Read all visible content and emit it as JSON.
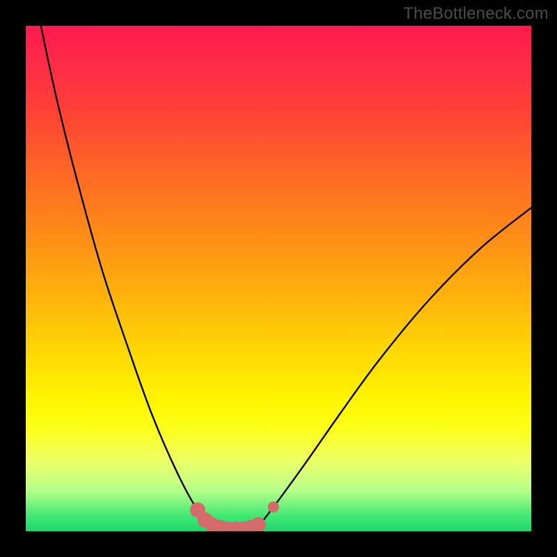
{
  "watermark": {
    "text": "TheBottleneck.com"
  },
  "background": {
    "gradient_stops": [
      {
        "pct": 0,
        "color": "#ff1a4e"
      },
      {
        "pct": 18,
        "color": "#ff4433"
      },
      {
        "pct": 42,
        "color": "#ff8e17"
      },
      {
        "pct": 64,
        "color": "#ffd605"
      },
      {
        "pct": 80,
        "color": "#fbff19"
      },
      {
        "pct": 92,
        "color": "#b6ff8a"
      },
      {
        "pct": 100,
        "color": "#1fd66e"
      }
    ]
  },
  "chart_data": {
    "type": "line",
    "title": "",
    "xlabel": "",
    "ylabel": "",
    "xlim": [
      0,
      100
    ],
    "ylim": [
      0,
      100
    ],
    "grid": false,
    "legend": null,
    "series": [
      {
        "name": "bottleneck-curve",
        "color": "#000000",
        "points": [
          {
            "x": 3.0,
            "y": 100.0
          },
          {
            "x": 6.0,
            "y": 86.0
          },
          {
            "x": 10.0,
            "y": 70.0
          },
          {
            "x": 15.0,
            "y": 52.0
          },
          {
            "x": 20.0,
            "y": 37.0
          },
          {
            "x": 25.0,
            "y": 23.0
          },
          {
            "x": 30.0,
            "y": 11.5
          },
          {
            "x": 34.0,
            "y": 4.2
          },
          {
            "x": 37.0,
            "y": 1.2
          },
          {
            "x": 40.0,
            "y": 0.4
          },
          {
            "x": 43.0,
            "y": 0.4
          },
          {
            "x": 46.0,
            "y": 1.3
          },
          {
            "x": 49.0,
            "y": 4.8
          },
          {
            "x": 55.0,
            "y": 13.0
          },
          {
            "x": 62.0,
            "y": 23.0
          },
          {
            "x": 70.0,
            "y": 34.0
          },
          {
            "x": 80.0,
            "y": 46.0
          },
          {
            "x": 90.0,
            "y": 56.0
          },
          {
            "x": 100.0,
            "y": 64.0
          }
        ]
      },
      {
        "name": "highlight-dots",
        "color": "#d46a6a",
        "points": [
          {
            "x": 34.0,
            "y": 4.2
          },
          {
            "x": 35.5,
            "y": 2.2
          },
          {
            "x": 37.0,
            "y": 1.2
          },
          {
            "x": 38.5,
            "y": 0.7
          },
          {
            "x": 40.0,
            "y": 0.4
          },
          {
            "x": 41.5,
            "y": 0.4
          },
          {
            "x": 43.0,
            "y": 0.4
          },
          {
            "x": 44.5,
            "y": 0.7
          },
          {
            "x": 46.0,
            "y": 1.3
          },
          {
            "x": 49.0,
            "y": 4.8
          }
        ]
      }
    ],
    "annotations": []
  }
}
